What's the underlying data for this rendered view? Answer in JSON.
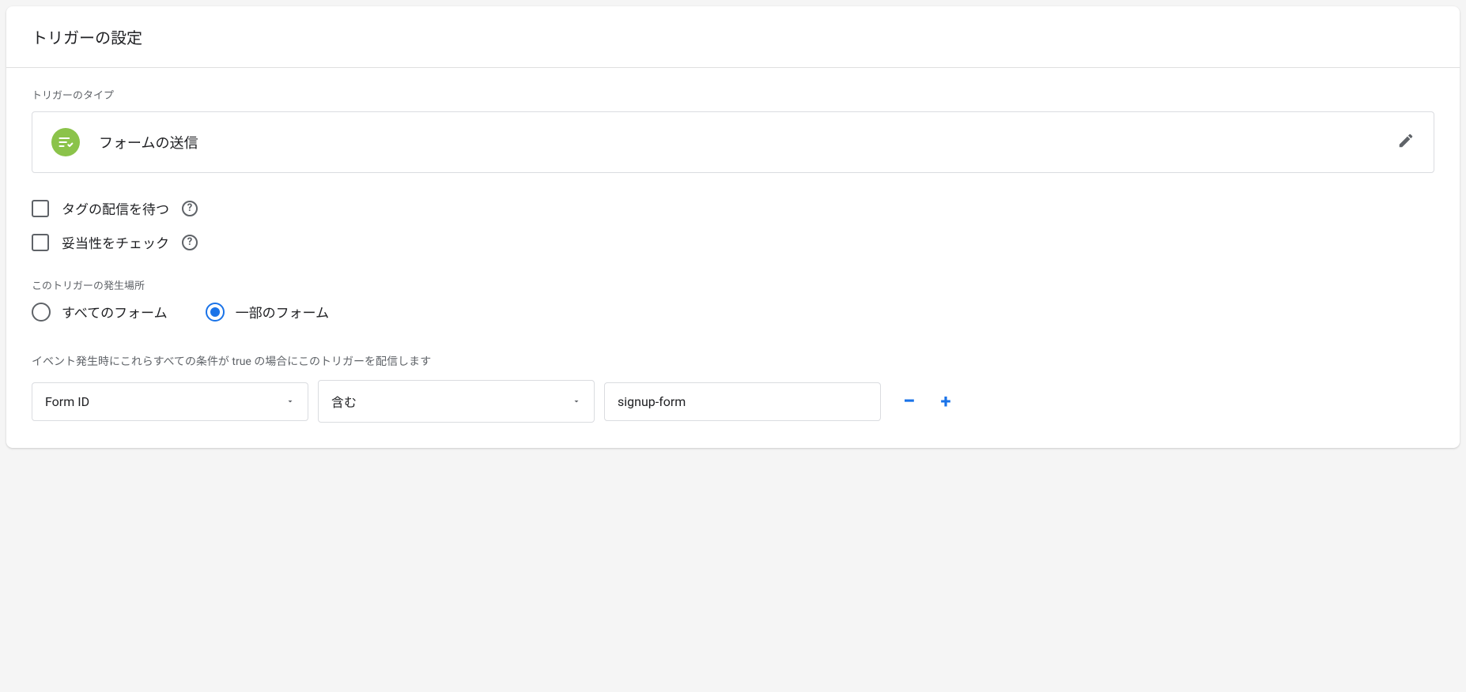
{
  "header": {
    "title": "トリガーの設定"
  },
  "triggerType": {
    "label": "トリガーのタイプ",
    "value": "フォームの送信"
  },
  "checkboxes": {
    "waitForTags": {
      "label": "タグの配信を待つ",
      "checked": false
    },
    "checkValidation": {
      "label": "妥当性をチェック",
      "checked": false
    }
  },
  "firesOn": {
    "label": "このトリガーの発生場所",
    "options": {
      "allForms": "すべてのフォーム",
      "someForms": "一部のフォーム"
    },
    "selected": "someForms"
  },
  "conditions": {
    "label": "イベント発生時にこれらすべての条件が true の場合にこのトリガーを配信します",
    "rows": [
      {
        "variable": "Form ID",
        "operator": "含む",
        "value": "signup-form"
      }
    ]
  }
}
